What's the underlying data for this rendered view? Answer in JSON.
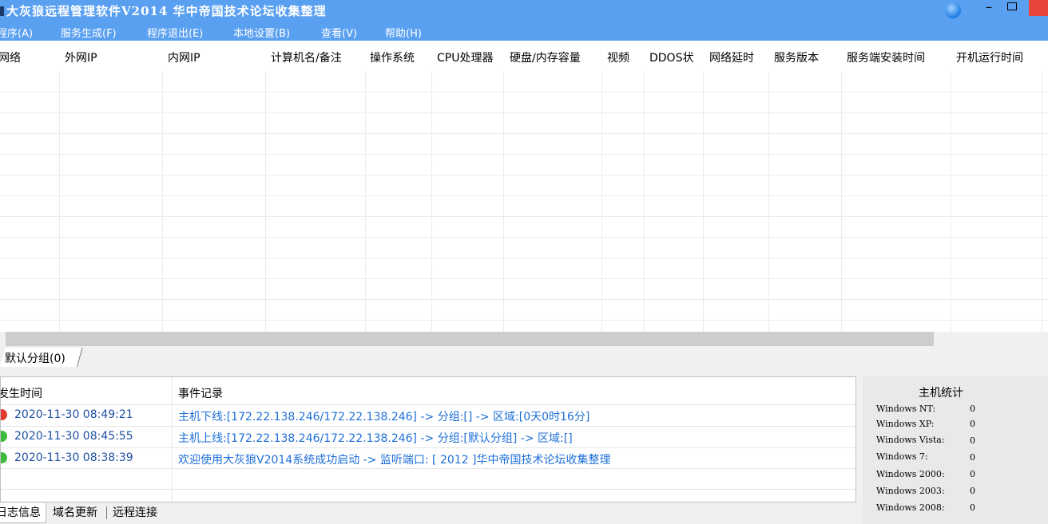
{
  "window": {
    "title": "大灰狼远程管理软件V2014   华中帝国技术论坛收集整理",
    "minimize_glyph": "–"
  },
  "menu": [
    "程序(A)",
    "服务生成(F)",
    "程序退出(E)",
    "本地设置(B)",
    "查看(V)",
    "帮助(H)"
  ],
  "grid": {
    "columns": [
      "网络",
      "外网IP",
      "内网IP",
      "计算机名/备注",
      "操作系统",
      "CPU处理器",
      "硬盘/内存容量",
      "视频",
      "DDOS状",
      "网络延时",
      "服务版本",
      "服务端安装时间",
      "开机运行时间"
    ]
  },
  "group_tab": {
    "label": "默认分组(0)"
  },
  "log": {
    "headers": {
      "time": "发生时间",
      "event": "事件记录"
    },
    "rows": [
      {
        "status": "offline",
        "time": "2020-11-30 08:49:21",
        "event": "主机下线:[172.22.138.246/172.22.138.246] -> 分组:[] -> 区域:[0天0时16分]"
      },
      {
        "status": "online",
        "time": "2020-11-30 08:45:55",
        "event": "主机上线:[172.22.138.246/172.22.138.246] -> 分组:[默认分组] -> 区域:[]"
      },
      {
        "status": "online",
        "time": "2020-11-30 08:38:39",
        "event": "欢迎使用大灰狼V2014系统成功启动 -> 监听端口: [ 2012 ]华中帝国技术论坛收集整理"
      }
    ]
  },
  "bottom_tabs": [
    "日志信息",
    "域名更新",
    "远程连接"
  ],
  "stats": {
    "title": "主机统计",
    "items": [
      {
        "label": "Windows NT:",
        "value": "0"
      },
      {
        "label": "Windows XP:",
        "value": "0"
      },
      {
        "label": "Windows Vista:",
        "value": "0"
      },
      {
        "label": "Windows 7:",
        "value": "0"
      },
      {
        "label": "Windows 2000:",
        "value": "0"
      },
      {
        "label": "Windows 2003:",
        "value": "0"
      },
      {
        "label": "Windows 2008:",
        "value": "0"
      }
    ]
  },
  "colors": {
    "titlebar": "#5aa0f0",
    "link_blue": "#1e6fd8",
    "status_offline": "#e23b2e",
    "status_online": "#3dbb3d"
  }
}
